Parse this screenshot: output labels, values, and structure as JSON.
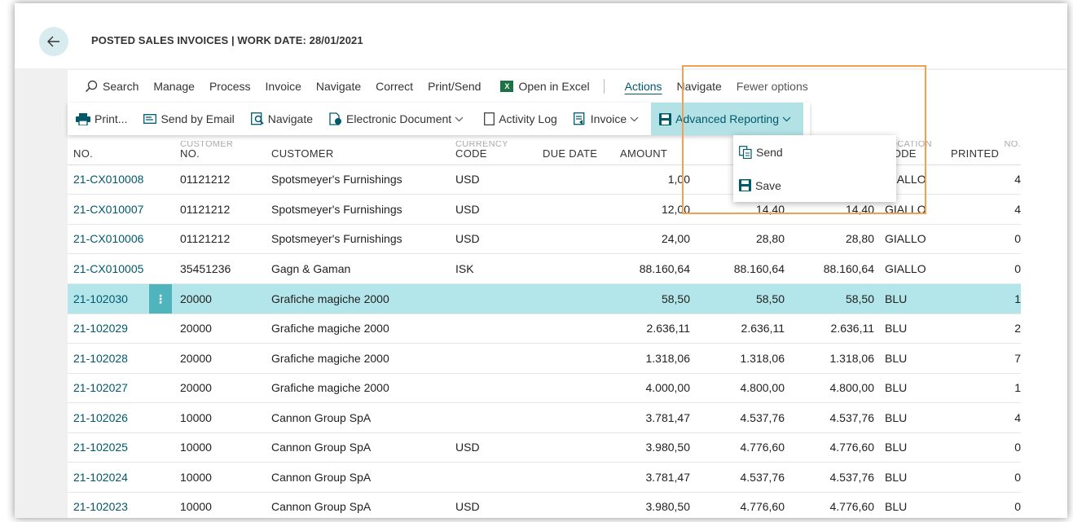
{
  "page": {
    "title": "POSTED SALES INVOICES | WORK DATE: 28/01/2021"
  },
  "commandbar": {
    "search": "Search",
    "items": [
      "Manage",
      "Process",
      "Invoice",
      "Navigate",
      "Correct",
      "Print/Send"
    ],
    "excel": "Open in Excel",
    "actions": "Actions",
    "navigate": "Navigate",
    "fewer": "Fewer options"
  },
  "actionbar": {
    "print": "Print...",
    "send_email": "Send by Email",
    "navigate": "Navigate",
    "electronic_document": "Electronic Document",
    "activity_log": "Activity Log",
    "invoice": "Invoice",
    "advanced_reporting": "Advanced Reporting"
  },
  "dropdown": {
    "send": "Send",
    "save": "Save"
  },
  "table": {
    "headers": {
      "no": "NO.",
      "customer_no_top": "CUSTOMER",
      "customer_no": "NO.",
      "customer": "CUSTOMER",
      "currency_top": "CURRENCY",
      "currency": "CODE",
      "due_date": "DUE DATE",
      "amount": "AMOUNT",
      "location_top": "LOCATION",
      "location": "CODE",
      "printed_top": "NO.",
      "printed": "PRINTED"
    },
    "rows": [
      {
        "no": "21-CX010008",
        "cno": "01121212",
        "customer": "Spotsmeyer's Furnishings",
        "currency": "USD",
        "due": "",
        "amount": "1,00",
        "amt2": "",
        "amt3": "",
        "loc": "GIALLO",
        "printed": "4"
      },
      {
        "no": "21-CX010007",
        "cno": "01121212",
        "customer": "Spotsmeyer's Furnishings",
        "currency": "USD",
        "due": "",
        "amount": "12,00",
        "amt2": "14,40",
        "amt3": "14,40",
        "loc": "GIALLO",
        "printed": "4"
      },
      {
        "no": "21-CX010006",
        "cno": "01121212",
        "customer": "Spotsmeyer's Furnishings",
        "currency": "USD",
        "due": "",
        "amount": "24,00",
        "amt2": "28,80",
        "amt3": "28,80",
        "loc": "GIALLO",
        "printed": "0"
      },
      {
        "no": "21-CX010005",
        "cno": "35451236",
        "customer": "Gagn & Gaman",
        "currency": "ISK",
        "due": "",
        "amount": "88.160,64",
        "amt2": "88.160,64",
        "amt3": "88.160,64",
        "loc": "GIALLO",
        "printed": "0"
      },
      {
        "no": "21-102030",
        "cno": "20000",
        "customer": "Grafiche magiche 2000",
        "currency": "",
        "due": "",
        "amount": "58,50",
        "amt2": "58,50",
        "amt3": "58,50",
        "loc": "BLU",
        "printed": "1"
      },
      {
        "no": "21-102029",
        "cno": "20000",
        "customer": "Grafiche magiche 2000",
        "currency": "",
        "due": "",
        "amount": "2.636,11",
        "amt2": "2.636,11",
        "amt3": "2.636,11",
        "loc": "BLU",
        "printed": "2"
      },
      {
        "no": "21-102028",
        "cno": "20000",
        "customer": "Grafiche magiche 2000",
        "currency": "",
        "due": "",
        "amount": "1.318,06",
        "amt2": "1.318,06",
        "amt3": "1.318,06",
        "loc": "BLU",
        "printed": "7"
      },
      {
        "no": "21-102027",
        "cno": "20000",
        "customer": "Grafiche magiche 2000",
        "currency": "",
        "due": "",
        "amount": "4.000,00",
        "amt2": "4.800,00",
        "amt3": "4.800,00",
        "loc": "BLU",
        "printed": "1"
      },
      {
        "no": "21-102026",
        "cno": "10000",
        "customer": "Cannon Group SpA",
        "currency": "",
        "due": "",
        "amount": "3.781,47",
        "amt2": "4.537,76",
        "amt3": "4.537,76",
        "loc": "BLU",
        "printed": "4"
      },
      {
        "no": "21-102025",
        "cno": "10000",
        "customer": "Cannon Group SpA",
        "currency": "USD",
        "due": "",
        "amount": "3.980,50",
        "amt2": "4.776,60",
        "amt3": "4.776,60",
        "loc": "BLU",
        "printed": "0"
      },
      {
        "no": "21-102024",
        "cno": "10000",
        "customer": "Cannon Group SpA",
        "currency": "",
        "due": "",
        "amount": "3.781,47",
        "amt2": "4.537,76",
        "amt3": "4.537,76",
        "loc": "BLU",
        "printed": "0"
      },
      {
        "no": "21-102023",
        "cno": "10000",
        "customer": "Cannon Group SpA",
        "currency": "USD",
        "due": "",
        "amount": "3.980,50",
        "amt2": "4.776,60",
        "amt3": "4.776,60",
        "loc": "BLU",
        "printed": "0"
      }
    ],
    "selected_row_menu": "⋮"
  },
  "colors": {
    "accent": "#00596b",
    "selected_row": "#b3e6ea",
    "highlight_button": "#b3e2e6",
    "annotation_box": "#f0a050"
  },
  "icons": [
    "back-arrow-icon",
    "search-icon",
    "excel-icon",
    "printer-icon",
    "email-icon",
    "navigate-icon",
    "electronic-document-icon",
    "activity-log-icon",
    "invoice-icon",
    "save-disk-icon",
    "chevron-down-icon",
    "send-icon",
    "row-menu-icon"
  ]
}
